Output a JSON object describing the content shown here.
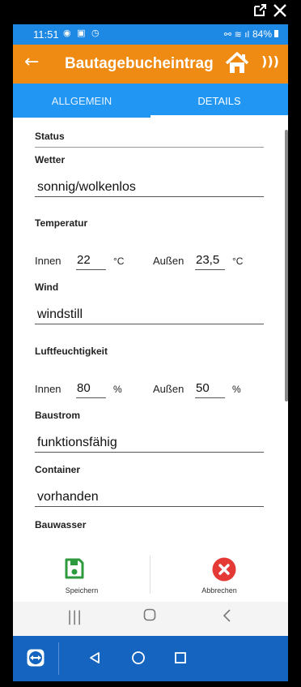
{
  "frame": {
    "external_icon": "external-link-icon",
    "close_icon": "close-icon"
  },
  "status_bar": {
    "time": "11:51",
    "battery": "84%"
  },
  "app_bar": {
    "title": "Bautagebucheintrag",
    "back_icon": "←",
    "nfc_icon": ")))"
  },
  "tabs": [
    {
      "label": "ALLGEMEIN",
      "active": false
    },
    {
      "label": "DETAILS",
      "active": true
    }
  ],
  "form": {
    "status_label": "Status",
    "wetter_label": "Wetter",
    "wetter_value": "sonnig/wolkenlos",
    "temperatur_label": "Temperatur",
    "temp_innen_label": "Innen",
    "temp_innen_value": "22",
    "temp_unit": "°C",
    "temp_aussen_label": "Außen",
    "temp_aussen_value": "23,5",
    "wind_label": "Wind",
    "wind_value": "windstill",
    "luft_label": "Luftfeuchtigkeit",
    "luft_innen_label": "Innen",
    "luft_innen_value": "80",
    "luft_unit": "%",
    "luft_aussen_label": "Außen",
    "luft_aussen_value": "50",
    "baustrom_label": "Baustrom",
    "baustrom_value": "funktionsfähig",
    "container_label": "Container",
    "container_value": "vorhanden",
    "bauwasser_label": "Bauwasser"
  },
  "actions": {
    "save_label": "Speichern",
    "cancel_label": "Abbrechen"
  },
  "colors": {
    "app_bar": "#ef8a12",
    "tabs": "#2196f3",
    "status_bar": "#1e88e5",
    "save": "#2e9a3e",
    "cancel": "#e53935",
    "bottom_bar": "#1565c0"
  }
}
